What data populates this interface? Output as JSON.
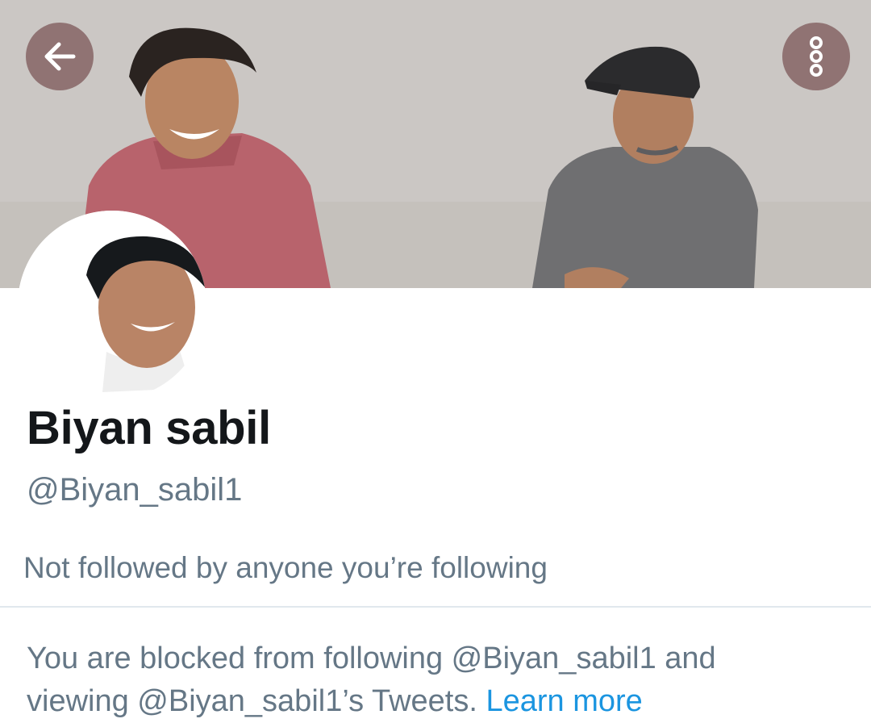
{
  "header": {
    "back_icon": "arrow-left-icon",
    "more_icon": "more-vertical-icon",
    "button_color": "#876868"
  },
  "profile": {
    "display_name": "Biyan sabil",
    "handle": "@Biyan_sabil1",
    "followed_by_text": "Not followed by anyone you’re following"
  },
  "blocked_notice": {
    "line1": "You are blocked from following @Biyan_sabil1 and",
    "line2": "viewing @Biyan_sabil1’s Tweets.",
    "link_text": "Learn more",
    "link_color": "#1b95e0"
  },
  "colors": {
    "name_text": "#14171a",
    "secondary_text": "#657786",
    "divider": "#e1e8ed"
  }
}
